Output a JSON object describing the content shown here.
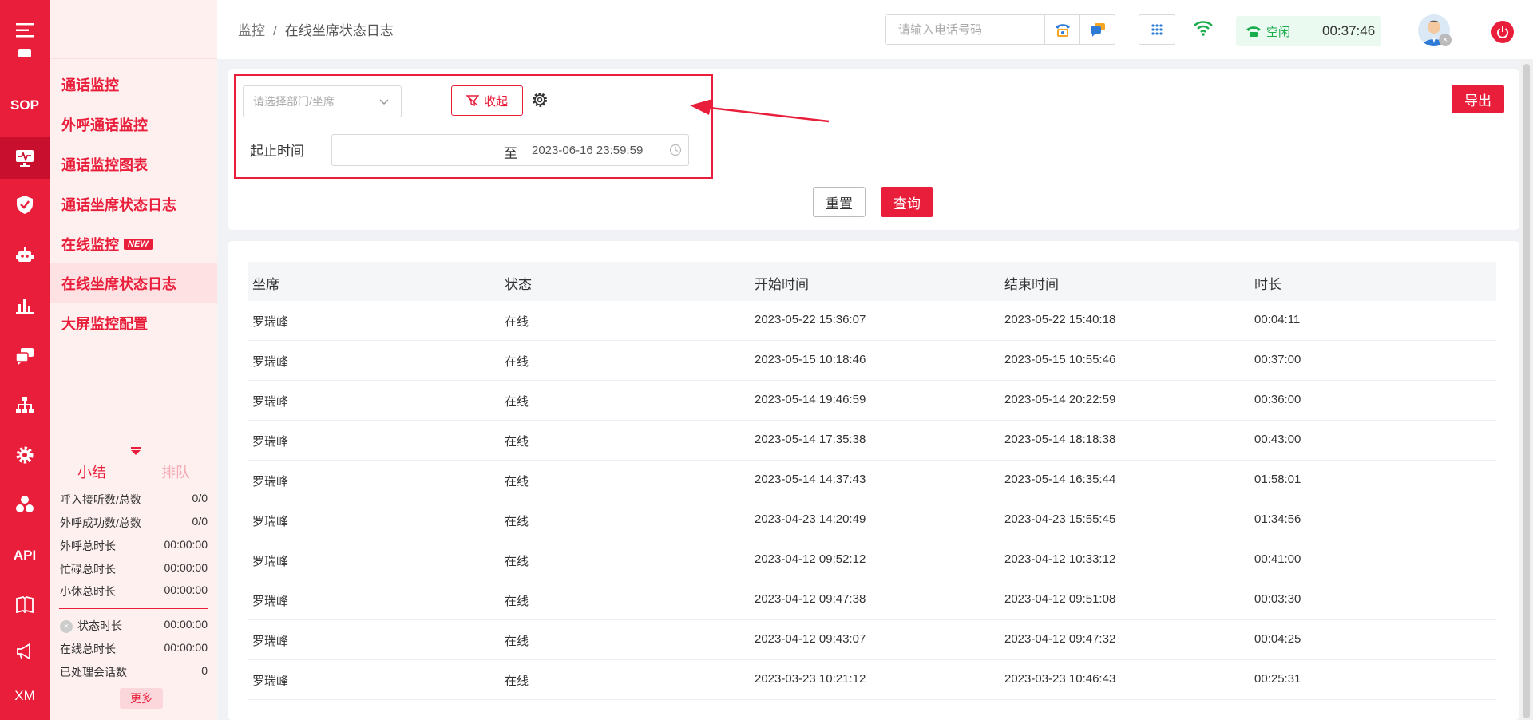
{
  "breadcrumb": {
    "root": "监控",
    "separator": "/",
    "current": "在线坐席状态日志"
  },
  "rail": {
    "items": [
      {
        "name": "menu-icon",
        "text": ""
      },
      {
        "name": "sop-icon",
        "text": "SOP"
      },
      {
        "name": "monitor-icon",
        "text": "",
        "active": true
      },
      {
        "name": "shield-icon",
        "text": ""
      },
      {
        "name": "robot-icon",
        "text": ""
      },
      {
        "name": "chart-icon",
        "text": ""
      },
      {
        "name": "chat-icon",
        "text": ""
      },
      {
        "name": "org-icon",
        "text": ""
      },
      {
        "name": "gear-icon",
        "text": ""
      },
      {
        "name": "cubes-icon",
        "text": ""
      },
      {
        "name": "api-icon",
        "text": "API"
      },
      {
        "name": "book-icon",
        "text": ""
      },
      {
        "name": "megaphone-icon",
        "text": ""
      },
      {
        "name": "xm-icon",
        "text": "XM"
      }
    ]
  },
  "subnav": {
    "items": [
      {
        "label": "通话监控"
      },
      {
        "label": "外呼通话监控"
      },
      {
        "label": "通话监控图表"
      },
      {
        "label": "通话坐席状态日志"
      },
      {
        "label": "在线监控",
        "badge": "NEW"
      },
      {
        "label": "在线坐席状态日志",
        "active": true
      },
      {
        "label": "大屏监控配置"
      }
    ]
  },
  "summary": {
    "tab_summary": "小结",
    "tab_queue": "排队",
    "rows": [
      {
        "label": "呼入接听数/总数",
        "value": "0/0"
      },
      {
        "label": "外呼成功数/总数",
        "value": "0/0"
      },
      {
        "label": "外呼总时长",
        "value": "00:00:00"
      },
      {
        "label": "忙碌总时长",
        "value": "00:00:00"
      },
      {
        "label": "小休总时长",
        "value": "00:00:00"
      }
    ],
    "rows2": [
      {
        "label": "状态时长",
        "value": "00:00:00"
      },
      {
        "label": "在线总时长",
        "value": "00:00:00"
      },
      {
        "label": "已处理会话数",
        "value": "0"
      }
    ],
    "more": "更多"
  },
  "header": {
    "phone_placeholder": "请输入电话号码",
    "status_label": "空闲",
    "status_time": "00:37:46"
  },
  "filter": {
    "dept_placeholder": "请选择部门/坐席",
    "collapse_label": "收起",
    "time_label": "起止时间",
    "range_separator": "至",
    "range_end": "2023-06-16 23:59:59",
    "export_label": "导出",
    "reset_label": "重置",
    "query_label": "查询"
  },
  "table": {
    "headers": [
      "坐席",
      "状态",
      "开始时间",
      "结束时间",
      "时长"
    ],
    "rows": [
      [
        "罗瑞峰",
        "在线",
        "2023-05-22 15:36:07",
        "2023-05-22 15:40:18",
        "00:04:11"
      ],
      [
        "罗瑞峰",
        "在线",
        "2023-05-15 10:18:46",
        "2023-05-15 10:55:46",
        "00:37:00"
      ],
      [
        "罗瑞峰",
        "在线",
        "2023-05-14 19:46:59",
        "2023-05-14 20:22:59",
        "00:36:00"
      ],
      [
        "罗瑞峰",
        "在线",
        "2023-05-14 17:35:38",
        "2023-05-14 18:18:38",
        "00:43:00"
      ],
      [
        "罗瑞峰",
        "在线",
        "2023-05-14 14:37:43",
        "2023-05-14 16:35:44",
        "01:58:01"
      ],
      [
        "罗瑞峰",
        "在线",
        "2023-04-23 14:20:49",
        "2023-04-23 15:55:45",
        "01:34:56"
      ],
      [
        "罗瑞峰",
        "在线",
        "2023-04-12 09:52:12",
        "2023-04-12 10:33:12",
        "00:41:00"
      ],
      [
        "罗瑞峰",
        "在线",
        "2023-04-12 09:47:38",
        "2023-04-12 09:51:08",
        "00:03:30"
      ],
      [
        "罗瑞峰",
        "在线",
        "2023-04-12 09:43:07",
        "2023-04-12 09:47:32",
        "00:04:25"
      ],
      [
        "罗瑞峰",
        "在线",
        "2023-03-23 10:21:12",
        "2023-03-23 10:46:43",
        "00:25:31"
      ]
    ]
  },
  "colors": {
    "accent": "#e81e3a",
    "sidebar_bg": "#fff0f0",
    "status_green": "#1aad4c"
  }
}
